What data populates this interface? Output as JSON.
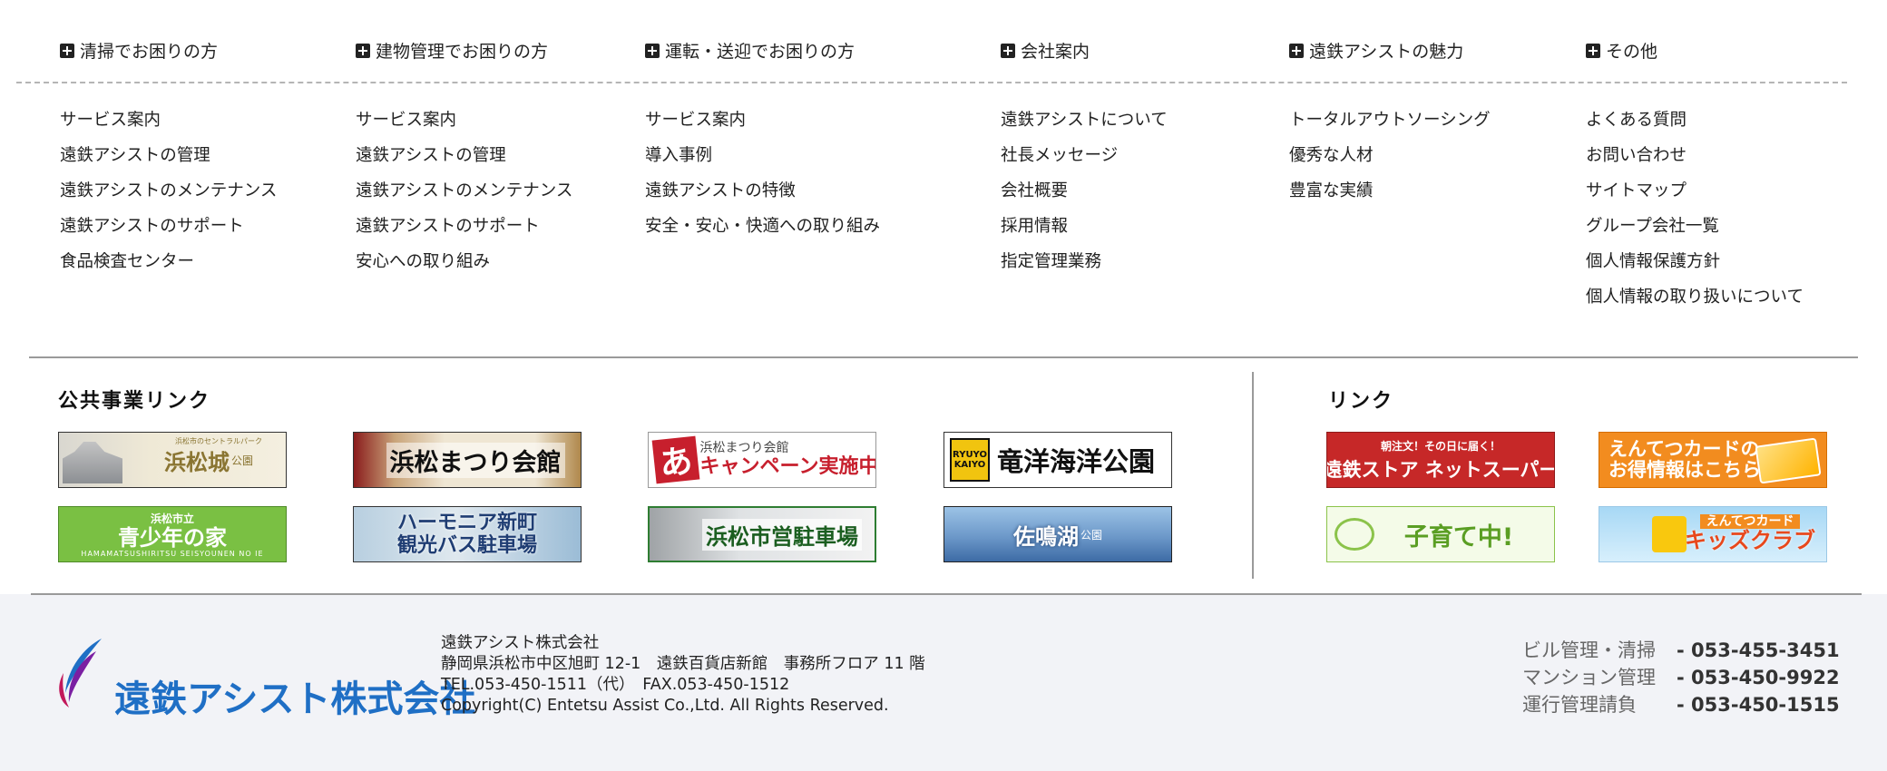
{
  "sitemap": {
    "columns": [
      {
        "heading": "清掃でお困りの方",
        "links": [
          "サービス案内",
          "遠鉄アシストの管理",
          "遠鉄アシストのメンテナンス",
          "遠鉄アシストのサポート",
          "食品検査センター"
        ]
      },
      {
        "heading": "建物管理でお困りの方",
        "links": [
          "サービス案内",
          "遠鉄アシストの管理",
          "遠鉄アシストのメンテナンス",
          "遠鉄アシストのサポート",
          "安心への取り組み"
        ]
      },
      {
        "heading": "運転・送迎でお困りの方",
        "links": [
          "サービス案内",
          "導入事例",
          "遠鉄アシストの特徴",
          "安全・安心・快適への取り組み"
        ]
      },
      {
        "heading": "会社案内",
        "links": [
          "遠鉄アシストについて",
          "社長メッセージ",
          "会社概要",
          "採用情報",
          "指定管理業務"
        ]
      },
      {
        "heading": "遠鉄アシストの魅力",
        "links": [
          "トータルアウトソーシング",
          "優秀な人材",
          "豊富な実績"
        ]
      },
      {
        "heading": "その他",
        "links": [
          "よくある質問",
          "お問い合わせ",
          "サイトマップ",
          "グループ会社一覧",
          "個人情報保護方針",
          "個人情報の取り扱いについて"
        ]
      }
    ]
  },
  "public_links": {
    "title": "公共事業リンク",
    "banners": {
      "castle": {
        "text": "浜松城",
        "suffix": "公園",
        "sub": "浜松市のセントラルパーク"
      },
      "matsuri": {
        "text": "浜松まつり会館"
      },
      "campaign": {
        "icon": "あ",
        "sub": "浜松まつり会館",
        "text": "キャンペーン実施中"
      },
      "ryuyo": {
        "logo_line1": "RYUYO",
        "logo_line2": "KAIYO",
        "text": "竜洋海洋公園"
      },
      "seishonen": {
        "sub": "浜松市立",
        "text": "青少年の家",
        "en": "HAMAMATSUSHIRITSU SEISYOUNEN NO IE"
      },
      "harmony": {
        "line1": "ハーモニア新町",
        "line2": "観光バス駐車場"
      },
      "parking": {
        "text": "浜松市営駐車場"
      },
      "sanaruko": {
        "text": "佐鳴湖",
        "suffix": "公園"
      }
    }
  },
  "links": {
    "title": "リンク",
    "banners": {
      "netsuper": {
        "sub": "朝注文！その日に届く！",
        "text": "遠鉄ストア ネットスーパー"
      },
      "entetsucard": {
        "line1": "えんてつカードの",
        "line2": "お得情報はこちら!"
      },
      "kosodate": {
        "text": "子育て中!"
      },
      "kids": {
        "sub": "えんてつカード",
        "text": "キッズクラブ"
      }
    }
  },
  "footer": {
    "logo_text": "遠鉄アシスト株式会社",
    "company_name": "遠鉄アシスト株式会社",
    "address": "静岡県浜松市中区旭町 12-1　遠鉄百貨店新館　事務所フロア 11 階",
    "tel_fax": "TEL.053-450-1511（代）　FAX.053-450-1512",
    "copyright": "Copyright(C) Entetsu Assist Co.,Ltd. All Rights Reserved.",
    "phones": [
      {
        "label": "ビル管理・清掃",
        "number": "- 053-455-3451"
      },
      {
        "label": "マンション管理",
        "number": "- 053-450-9922"
      },
      {
        "label": "運行管理請負",
        "number": "- 053-450-1515"
      }
    ],
    "brand_color": "#1f6fc5",
    "logo_accent_colors": [
      "#c2185b",
      "#7b1fa2",
      "#1f6fc5"
    ]
  }
}
